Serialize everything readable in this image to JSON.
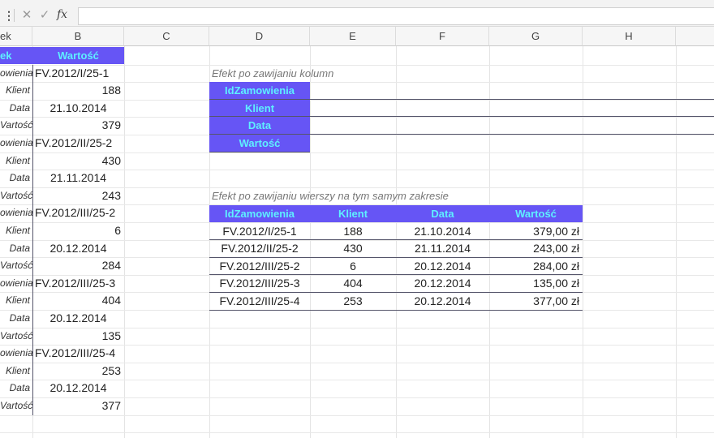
{
  "formula_bar": {
    "name_box_menu": "⋮",
    "cancel": "✕",
    "enter": "✓",
    "fx": "fx",
    "content": ""
  },
  "columns": {
    "A": "ek",
    "B": "B",
    "C": "C",
    "D": "D",
    "E": "E",
    "F": "F",
    "G": "G",
    "H": "H"
  },
  "col_b_header": "Wartość",
  "left_rows": [
    {
      "label": "owienia",
      "value": "FV.2012/I/25-1"
    },
    {
      "label": "Klient",
      "value": "188"
    },
    {
      "label": "Data",
      "value": "21.10.2014"
    },
    {
      "label": "Vartość",
      "value": "379"
    },
    {
      "label": "owienia",
      "value": "FV.2012/II/25-2"
    },
    {
      "label": "Klient",
      "value": "430"
    },
    {
      "label": "Data",
      "value": "21.11.2014"
    },
    {
      "label": "Vartość",
      "value": "243"
    },
    {
      "label": "owienia",
      "value": "FV.2012/III/25-2"
    },
    {
      "label": "Klient",
      "value": "6"
    },
    {
      "label": "Data",
      "value": "20.12.2014"
    },
    {
      "label": "Vartość",
      "value": "284"
    },
    {
      "label": "owienia",
      "value": "FV.2012/III/25-3"
    },
    {
      "label": "Klient",
      "value": "404"
    },
    {
      "label": "Data",
      "value": "20.12.2014"
    },
    {
      "label": "Vartość",
      "value": "135"
    },
    {
      "label": "owienia",
      "value": "FV.2012/III/25-4"
    },
    {
      "label": "Klient",
      "value": "253"
    },
    {
      "label": "Data",
      "value": "20.12.2014"
    },
    {
      "label": "Vartość",
      "value": "377"
    }
  ],
  "column_wrap": {
    "caption": "Efekt po zawijaniu kolumn",
    "fields": [
      "IdZamowienia",
      "Klient",
      "Data",
      "Wartość"
    ]
  },
  "row_wrap": {
    "caption": "Efekt po zawijaniu wierszy na tym samym zakresie",
    "headers": [
      "IdZamowienia",
      "Klient",
      "Data",
      "Wartość"
    ],
    "rows": [
      [
        "FV.2012/I/25-1",
        "188",
        "21.10.2014",
        "379,00 zł"
      ],
      [
        "FV.2012/II/25-2",
        "430",
        "21.11.2014",
        "243,00 zł"
      ],
      [
        "FV.2012/III/25-2",
        "6",
        "20.12.2014",
        "284,00 zł"
      ],
      [
        "FV.2012/III/25-3",
        "404",
        "20.12.2014",
        "135,00 zł"
      ],
      [
        "FV.2012/III/25-4",
        "253",
        "20.12.2014",
        "377,00 zł"
      ]
    ]
  },
  "colors": {
    "header_fill": "#6655f5",
    "header_text": "#5ef0ff",
    "caption_text": "#777777"
  }
}
